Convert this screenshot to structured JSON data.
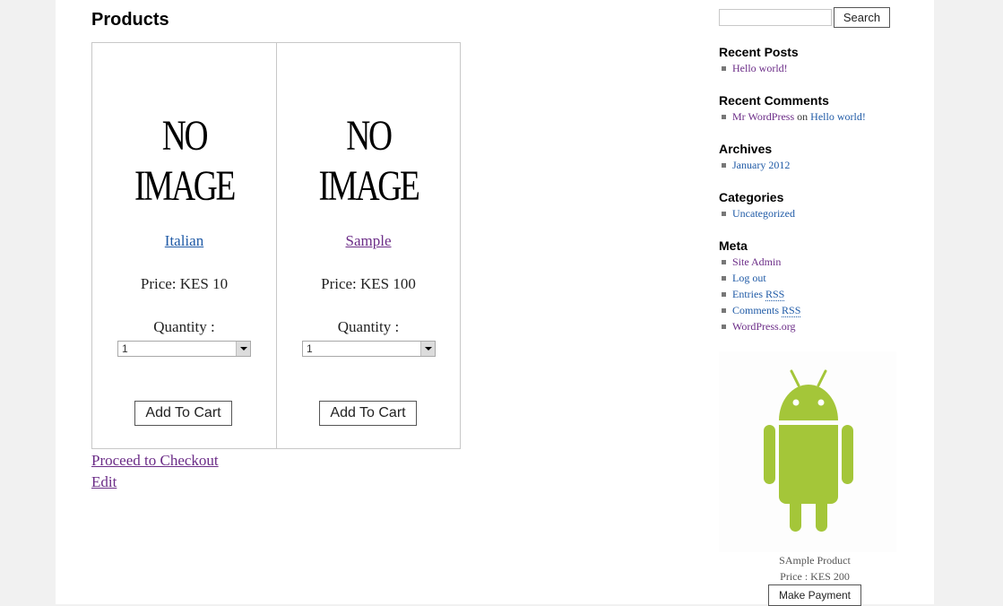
{
  "main": {
    "title": "Products",
    "products": [
      {
        "image_text": "NO IMAGE",
        "name": "Italian",
        "price_text": "Price: KES 10",
        "quantity_label": "Quantity :",
        "quantity_value": "1",
        "add_to_cart_label": "Add To Cart"
      },
      {
        "image_text": "NO IMAGE",
        "name": "Sample",
        "price_text": "Price: KES 100",
        "quantity_label": "Quantity :",
        "quantity_value": "1",
        "add_to_cart_label": "Add To Cart"
      }
    ],
    "checkout_link": "Proceed to Checkout",
    "edit_link": "Edit"
  },
  "sidebar": {
    "search": {
      "value": "",
      "button_label": "Search"
    },
    "recent_posts": {
      "title": "Recent Posts",
      "items": [
        "Hello world!"
      ]
    },
    "recent_comments": {
      "title": "Recent Comments",
      "author": "Mr WordPress",
      "connector": "on",
      "post": "Hello world!"
    },
    "archives": {
      "title": "Archives",
      "items": [
        "January 2012"
      ]
    },
    "categories": {
      "title": "Categories",
      "items": [
        "Uncategorized"
      ]
    },
    "meta": {
      "title": "Meta",
      "site_admin": "Site Admin",
      "log_out": "Log out",
      "entries_prefix": "Entries",
      "entries_rss": "RSS",
      "comments_prefix": "Comments",
      "comments_rss": "RSS",
      "wordpress_org": "WordPress.org"
    },
    "product": {
      "image_icon": "android-robot-icon",
      "name": "SAmple Product",
      "price_text": "Price : KES 200",
      "button_label": "Make Payment"
    }
  },
  "colors": {
    "link_blue": "#1f5aa6",
    "link_purple": "#6b2c87",
    "android_green": "#a4c639",
    "page_bg": "#f1f1f1"
  }
}
